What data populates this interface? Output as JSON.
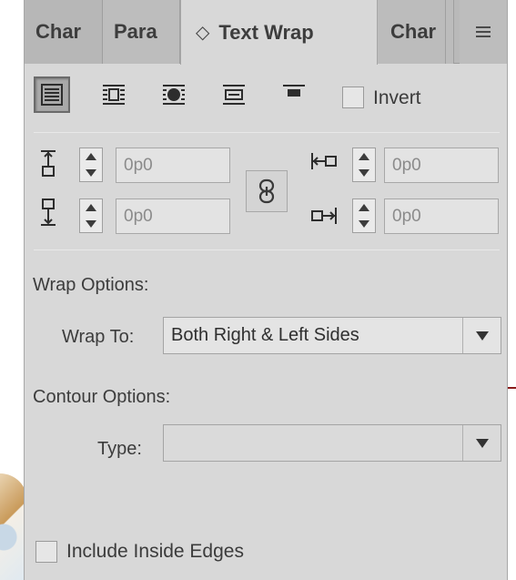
{
  "tabs": [
    {
      "label": "Char"
    },
    {
      "label": "Para"
    },
    {
      "label": "Text Wrap",
      "arrows": "◇"
    },
    {
      "label": "Char"
    }
  ],
  "menu_icon": "hamburger-menu-icon",
  "wrap_modes": [
    {
      "name": "no-text-wrap-icon",
      "active": true
    },
    {
      "name": "wrap-around-bounding-box-icon",
      "active": false
    },
    {
      "name": "wrap-around-object-shape-icon",
      "active": false
    },
    {
      "name": "jump-object-icon",
      "active": false
    },
    {
      "name": "jump-to-next-column-icon",
      "active": false
    }
  ],
  "invert": {
    "label": "Invert",
    "checked": false
  },
  "offsets": {
    "top": "0p0",
    "bottom": "0p0",
    "left": "0p0",
    "right": "0p0"
  },
  "wrap_options": {
    "title": "Wrap Options:",
    "wrap_to_label": "Wrap To:",
    "wrap_to_value": "Both Right & Left Sides"
  },
  "contour_options": {
    "title": "Contour Options:",
    "type_label": "Type:",
    "type_value": ""
  },
  "include_inside_edges": {
    "label": "Include Inside Edges",
    "checked": false
  },
  "colors": {
    "panel_bg": "#d8d8d8",
    "tabbar_bg": "#b9b9b9",
    "field_bg": "#e3e3e3"
  }
}
